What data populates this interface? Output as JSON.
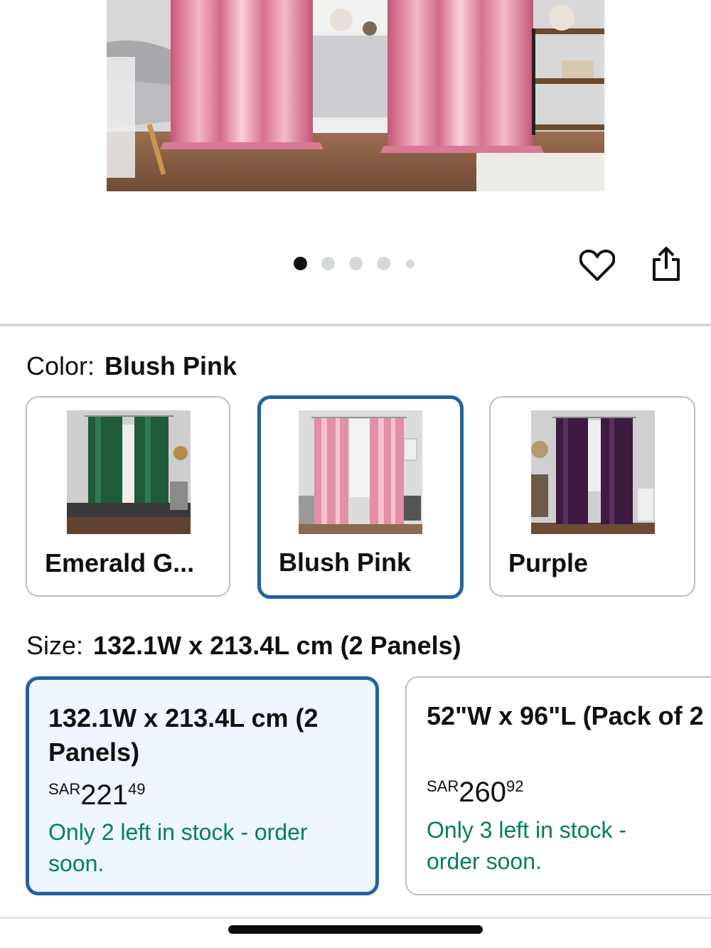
{
  "carousel": {
    "image_count": 5,
    "active_index": 0
  },
  "actions": {
    "wishlist_icon": "heart-icon",
    "share_icon": "share-icon"
  },
  "color": {
    "label": "Color:",
    "selected": "Blush Pink",
    "options": [
      {
        "label": "Emerald G...",
        "thumb_color": "#1f5a3a"
      },
      {
        "label": "Blush Pink",
        "thumb_color": "#e38fa6"
      },
      {
        "label": "Purple",
        "thumb_color": "#3d1a3f"
      }
    ]
  },
  "size": {
    "label": "Size:",
    "selected": "132.1W x 213.4L cm (2 Panels)",
    "options": [
      {
        "title": "132.1W x 213.4L cm (2 Panels)",
        "currency": "SAR",
        "price_whole": "221",
        "price_fraction": "49",
        "stock": "Only 2 left in stock - order soon."
      },
      {
        "title": "52\"W x 96\"L (Pack of 2",
        "currency": "SAR",
        "price_whole": "260",
        "price_fraction": "92",
        "stock": "Only 3 left in stock - order soon."
      }
    ]
  },
  "colors": {
    "selected_border": "#2162a1",
    "selected_bg": "#edf7fd",
    "stock_green": "#067d62",
    "divider": "#d5d9d9"
  }
}
